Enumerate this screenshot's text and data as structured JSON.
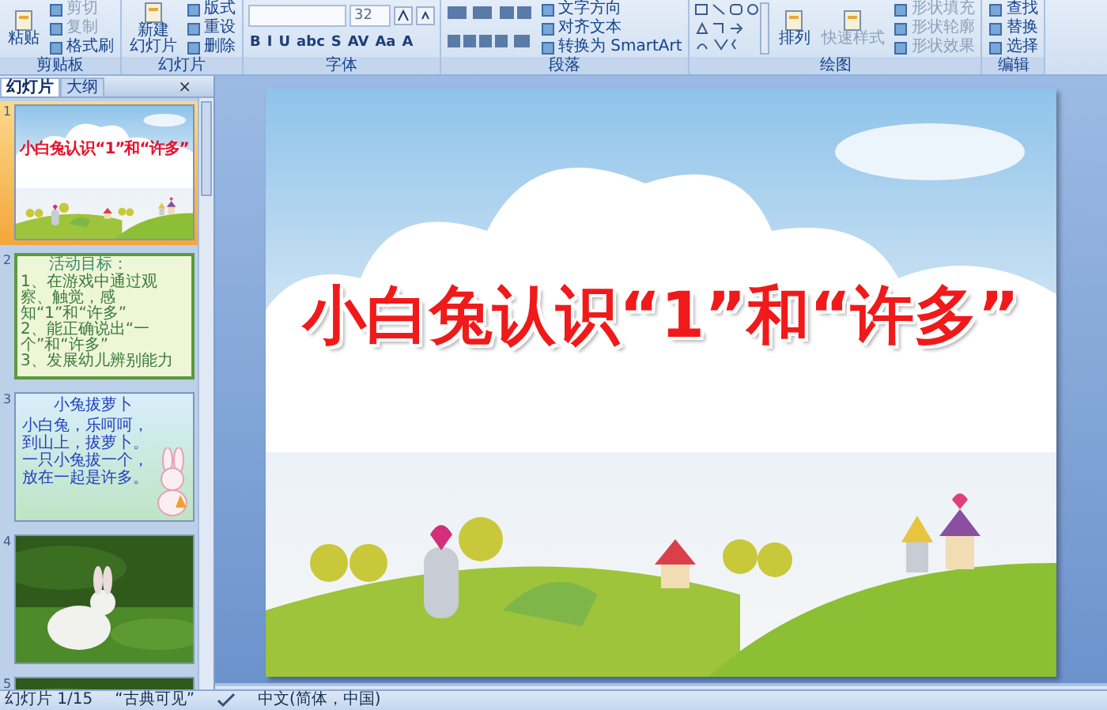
{
  "ribbon": {
    "groups": [
      {
        "label": "剪贴板",
        "items": [
          {
            "kind": "large",
            "lines": [
              "粘贴"
            ],
            "disabled": false
          },
          {
            "kind": "stack",
            "entries": [
              {
                "label": "剪切",
                "disabled": true
              },
              {
                "label": "复制",
                "disabled": true
              },
              {
                "label": "格式刷",
                "disabled": false
              }
            ]
          }
        ]
      },
      {
        "label": "幻灯片",
        "items": [
          {
            "kind": "large",
            "lines": [
              "新建",
              "幻灯片"
            ],
            "disabled": false
          },
          {
            "kind": "stack",
            "entries": [
              {
                "label": "版式",
                "disabled": false
              },
              {
                "label": "重设",
                "disabled": false
              },
              {
                "label": "删除",
                "disabled": false
              }
            ]
          }
        ]
      },
      {
        "label": "字体",
        "items": [
          {
            "kind": "font",
            "size": "32",
            "glyphs": [
              "B",
              "I",
              "U",
              "abc",
              "S",
              "AV",
              "Aa",
              "A"
            ]
          }
        ]
      },
      {
        "label": "段落",
        "items": [
          {
            "kind": "paragraph"
          },
          {
            "kind": "stack",
            "entries": [
              {
                "label": "文字方向",
                "disabled": false
              },
              {
                "label": "对齐文本",
                "disabled": false
              },
              {
                "label": "转换为 SmartArt",
                "disabled": false
              }
            ]
          }
        ]
      },
      {
        "label": "绘图",
        "items": [
          {
            "kind": "shapes"
          },
          {
            "kind": "large",
            "lines": [
              "排列"
            ],
            "disabled": false
          },
          {
            "kind": "large",
            "lines": [
              "快速样式"
            ],
            "disabled": true
          },
          {
            "kind": "stack",
            "entries": [
              {
                "label": "形状填充",
                "disabled": true
              },
              {
                "label": "形状轮廓",
                "disabled": true
              },
              {
                "label": "形状效果",
                "disabled": true
              }
            ]
          }
        ]
      },
      {
        "label": "编辑",
        "items": [
          {
            "kind": "stack",
            "entries": [
              {
                "label": "查找",
                "disabled": false
              },
              {
                "label": "替换",
                "disabled": false
              },
              {
                "label": "选择",
                "disabled": false
              }
            ]
          }
        ]
      }
    ]
  },
  "panel": {
    "tabs": [
      {
        "label": "幻灯片",
        "selected": true
      },
      {
        "label": "大纲",
        "selected": false
      }
    ],
    "close": "×",
    "slides": [
      {
        "number": "1",
        "selected": true,
        "kind": "title",
        "title": "小白兔认识“1”和“许多”"
      },
      {
        "number": "2",
        "selected": false,
        "kind": "goals",
        "heading": "活动目标：",
        "points": [
          "1、在游戏中通过观察、触觉，感知“1”和“许多”",
          "2、能正确说出“一个”和“许多”",
          "3、发展幼儿辨别能力"
        ]
      },
      {
        "number": "3",
        "selected": false,
        "kind": "poem",
        "heading": "小兔拔萝卜",
        "lines": [
          "小白兔，乐呵呵，",
          "到山上，拔萝卜。",
          "一只小兔拔一个，",
          "放在一起是许多。"
        ]
      },
      {
        "number": "4",
        "selected": false
      },
      {
        "number": "5",
        "selected": false
      }
    ]
  },
  "slide": {
    "title": "小白兔认识“1”和“许多”"
  },
  "status_bar": {
    "slide": "幻灯片 1/15",
    "theme": "“古典可见”",
    "language": "中文(简体，中国)"
  }
}
